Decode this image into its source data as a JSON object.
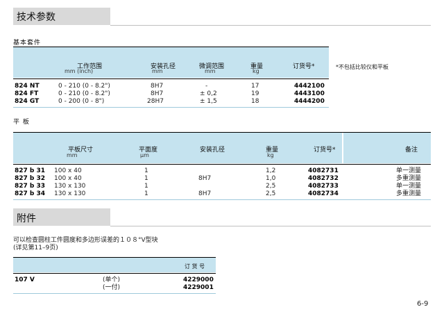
{
  "tech": {
    "title": "技术参数",
    "basic": {
      "subtitle": "基本套件",
      "headers": {
        "range": "工作范围",
        "range_units": "mm        (inch)",
        "hole": "安装孔径",
        "hole_units": "mm",
        "fine": "微调范围",
        "fine_units": "mm",
        "weight": "重量",
        "weight_units": "kg",
        "order": "订货号*"
      },
      "note": "*不包括比较仪和平板",
      "rows": [
        {
          "model": "824 NT",
          "range": "0 - 210  (0 - 8.2\")",
          "hole": "8H7",
          "fine": "-",
          "weight": "17",
          "order": "4442100"
        },
        {
          "model": "824 FT",
          "range": "0 - 210  (0 - 8.2\")",
          "hole": "8H7",
          "fine": "± 0,2",
          "weight": "19",
          "order": "4443100"
        },
        {
          "model": "824 GT",
          "range": "0 - 200  (0 -  8\")",
          "hole": "28H7",
          "fine": "± 1,5",
          "weight": "18",
          "order": "4444200"
        }
      ]
    },
    "plate": {
      "subtitle": "平 板",
      "headers": {
        "size": "平板尺寸",
        "size_units": "mm",
        "flat": "平面度",
        "flat_units": "µm",
        "hole": "安装孔径",
        "weight": "重量",
        "weight_units": "kg",
        "order": "订货号*",
        "remark": "备注"
      },
      "rows": [
        {
          "model": "827 b 31",
          "size": "100 x  40",
          "flat": "1",
          "hole": "",
          "weight": "1,2",
          "order": "4082731",
          "remark": "单一测量"
        },
        {
          "model": "827 b 32",
          "size": "100 x  40",
          "flat": "1",
          "hole": "8H7",
          "weight": "1,0",
          "order": "4082732",
          "remark": "多重测量"
        },
        {
          "model": "827 b 33",
          "size": "130 x 130",
          "flat": "1",
          "hole": "",
          "weight": "2,5",
          "order": "4082733",
          "remark": "单一测量"
        },
        {
          "model": "827 b 34",
          "size": "130 x 130",
          "flat": "1",
          "hole": "8H7",
          "weight": "2,5",
          "order": "4082734",
          "remark": "多重测量"
        }
      ]
    }
  },
  "accessory": {
    "title": "附件",
    "desc1": "可以检查圆柱工件圆度和多边形误差的１０８°V型块",
    "desc2": "(详见第11–9页)",
    "order_header": "订 货 号",
    "model": "107 V",
    "items": [
      {
        "label": "(单个)",
        "order": "4229000"
      },
      {
        "label": "(一付)",
        "order": "4229001"
      }
    ]
  },
  "page_number": "6-9"
}
